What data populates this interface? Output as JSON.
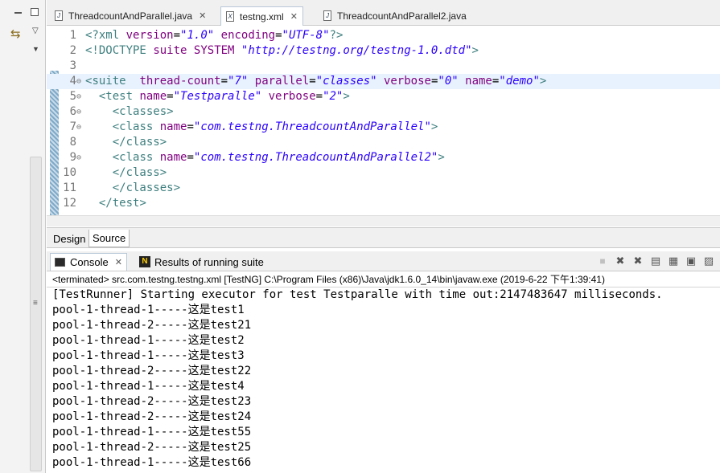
{
  "left_panel": {
    "minimize_label": "",
    "maximize_label": ""
  },
  "editor_tabs": [
    {
      "label": "ThreadcountAndParallel.java",
      "icon": "java-file-icon",
      "active": false,
      "closable": true
    },
    {
      "label": "testng.xml",
      "icon": "xml-file-icon",
      "active": true,
      "closable": true
    },
    {
      "label": "ThreadcountAndParallel2.java",
      "icon": "java-file-icon",
      "active": false,
      "closable": false
    }
  ],
  "code_lines": [
    {
      "num": "1",
      "fold": "",
      "text": "<?xml version=\"1.0\" encoding=\"UTF-8\"?>"
    },
    {
      "num": "2",
      "fold": "",
      "text": "<!DOCTYPE suite SYSTEM \"http://testng.org/testng-1.0.dtd\">"
    },
    {
      "num": "3",
      "fold": "",
      "text": ""
    },
    {
      "num": "4",
      "fold": "⊖",
      "text": "<suite  thread-count=\"7\" parallel=\"classes\" verbose=\"0\" name=\"demo\">"
    },
    {
      "num": "5",
      "fold": "⊖",
      "text": "  <test name=\"Testparalle\" verbose=\"2\">"
    },
    {
      "num": "6",
      "fold": "⊖",
      "text": "    <classes>"
    },
    {
      "num": "7",
      "fold": "⊖",
      "text": "    <class name=\"com.testng.ThreadcountAndParallel\">"
    },
    {
      "num": "8",
      "fold": "",
      "text": "    </class>"
    },
    {
      "num": "9",
      "fold": "⊖",
      "text": "    <class name=\"com.testng.ThreadcountAndParallel2\">"
    },
    {
      "num": "10",
      "fold": "",
      "text": "    </class>"
    },
    {
      "num": "11",
      "fold": "",
      "text": "    </classes>"
    },
    {
      "num": "12",
      "fold": "",
      "text": "  </test>"
    }
  ],
  "design_tabs": {
    "design": "Design",
    "source": "Source"
  },
  "console": {
    "tab_label": "Console",
    "results_tab_label": "Results of running suite",
    "terminated_line": "<terminated> src.com.testng.testng.xml [TestNG] C:\\Program Files (x86)\\Java\\jdk1.6.0_14\\bin\\javaw.exe (2019-6-22 下午1:39:41)",
    "tools": [
      "terminate-icon",
      "remove-launch-icon",
      "remove-all-icon",
      "scroll-lock-icon",
      "clear-console-icon",
      "pin-console-icon",
      "display-console-icon"
    ],
    "output": [
      "[TestRunner] Starting executor for test Testparalle with time out:2147483647 milliseconds.",
      "pool-1-thread-1-----这是test1",
      "pool-1-thread-2-----这是test21",
      "pool-1-thread-1-----这是test2",
      "pool-1-thread-1-----这是test3",
      "pool-1-thread-2-----这是test22",
      "pool-1-thread-1-----这是test4",
      "pool-1-thread-2-----这是test23",
      "pool-1-thread-2-----这是test24",
      "pool-1-thread-1-----这是test55",
      "pool-1-thread-2-----这是test25",
      "pool-1-thread-1-----这是test66"
    ]
  }
}
